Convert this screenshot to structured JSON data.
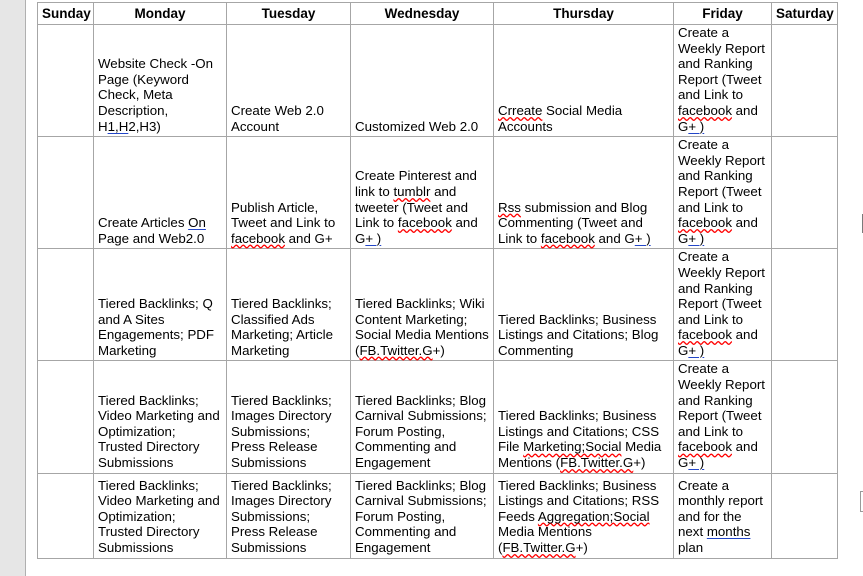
{
  "document": {
    "type": "word-processor-document",
    "page_background": "#ffffff",
    "app_background": "#e6e6e6",
    "link_color": "#2346c8",
    "spellcheck_color": "#ff0000",
    "border_color": "#a6a6a6"
  },
  "table": {
    "headers": [
      "Sunday",
      "Monday",
      "Tuesday",
      "Wednesday",
      "Thursday",
      "Friday",
      "Saturday"
    ],
    "rows": [
      {
        "sunday": "",
        "monday": "Website Check -On Page (Keyword Check, Meta Description, H1,H2,H3)",
        "tuesday": "Create Web 2.0 Account",
        "wednesday": "Customized Web 2.0",
        "thursday": "Crreate Social Media Accounts",
        "friday": "Create a Weekly Report and Ranking Report (Tweet and Link to facebook and G+ )",
        "saturday": ""
      },
      {
        "sunday": "",
        "monday": "Create Articles On Page and Web2.0",
        "tuesday": "Publish Article, Tweet and Link to facebook and G+",
        "wednesday": "Create Pinterest and link to tumblr and tweeter (Tweet and Link to facebook and G+ )",
        "thursday": "Rss submission and Blog Commenting (Tweet and Link to facebook and G+ )",
        "friday": "Create a Weekly Report and Ranking Report (Tweet and Link to facebook and G+ )",
        "saturday": ""
      },
      {
        "sunday": "",
        "monday": "Tiered Backlinks; Q and A Sites Engagements; PDF Marketing",
        "tuesday": "Tiered Backlinks; Classified Ads Marketing; Article Marketing",
        "wednesday": "Tiered Backlinks; Wiki Content Marketing; Social Media Mentions (FB.Twitter.G+)",
        "thursday": "Tiered Backlinks; Business Listings and Citations; Blog Commenting",
        "friday": "Create a Weekly Report and Ranking Report (Tweet and Link to facebook and G+ )",
        "saturday": ""
      },
      {
        "sunday": "",
        "monday": "Tiered Backlinks; Video Marketing and Optimization; Trusted Directory Submissions",
        "tuesday": "Tiered Backlinks; Images Directory Submissions; Press Release Submissions",
        "wednesday": "Tiered Backlinks; Blog Carnival Submissions; Forum Posting, Commenting and Engagement",
        "thursday": "Tiered Backlinks; Business Listings and Citations; CSS File Marketing;Social Media Mentions (FB.Twitter.G+)",
        "friday": "Create a Weekly Report and Ranking Report (Tweet and Link to facebook and G+ )",
        "saturday": ""
      },
      {
        "sunday": "",
        "monday": "Tiered Backlinks; Video Marketing and Optimization; Trusted Directory Submissions",
        "tuesday": "Tiered Backlinks; Images Directory Submissions; Press Release Submissions",
        "wednesday": "Tiered Backlinks; Blog Carnival Submissions; Forum Posting, Commenting and Engagement",
        "thursday": "Tiered Backlinks; Business Listings and Citations; RSS Feeds Aggregation;Social Media Mentions (FB.Twitter.G+)",
        "friday": "Create a monthly report and for the next months plan",
        "saturday": ""
      }
    ]
  }
}
